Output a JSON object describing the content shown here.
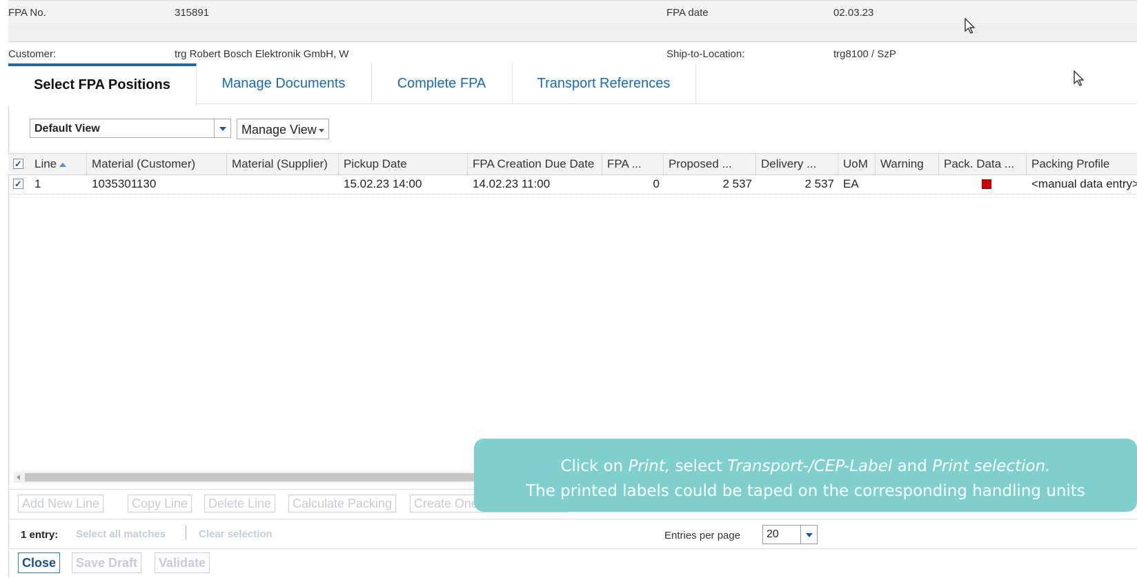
{
  "header": {
    "fpa_no_label": "FPA No.",
    "fpa_no_value": "315891",
    "fpa_date_label": "FPA date",
    "fpa_date_value": "02.03.23",
    "customer_label": "Customer:",
    "customer_value": "trg Robert Bosch Elektronik GmbH, W",
    "ship_to_label": "Ship-to-Location:",
    "ship_to_value": "trg8100 / SzP"
  },
  "tabs": [
    {
      "label": "Select FPA Positions",
      "active": true
    },
    {
      "label": "Manage Documents",
      "active": false
    },
    {
      "label": "Complete FPA",
      "active": false
    },
    {
      "label": "Transport References",
      "active": false
    }
  ],
  "view": {
    "selected": "Default View",
    "manage_label": "Manage View"
  },
  "grid": {
    "columns": [
      "Line",
      "Material (Customer)",
      "Material (Supplier)",
      "Pickup Date",
      "FPA Creation Due Date",
      "FPA ...",
      "Proposed ...",
      "Delivery ...",
      "UoM",
      "Warning",
      "Pack. Data ...",
      "Packing Profile"
    ],
    "rows": [
      {
        "line": "1",
        "material_customer": "1035301130",
        "material_supplier": "",
        "pickup_date": "15.02.23 14:00",
        "due_date": "14.02.23 11:00",
        "fpa": "0",
        "proposed": "2 537",
        "delivery": "2 537",
        "uom": "EA",
        "warning": "",
        "pack_data_status": "red",
        "packing_profile": "<manual data entry>"
      }
    ]
  },
  "toolbar": {
    "add_new_line": "Add New Line",
    "copy_line": "Copy Line",
    "delete_line": "Delete Line",
    "calculate_packing": "Calculate Packing",
    "create_one": "Create One"
  },
  "footer": {
    "entries": "1 entry:",
    "select_all": "Select all matches",
    "clear_selection": "Clear selection",
    "entries_per_page_label": "Entries per page",
    "entries_per_page_value": "20"
  },
  "actions": {
    "close": "Close",
    "save_draft": "Save Draft",
    "validate": "Validate"
  },
  "callout": {
    "line1_a": "Click on ",
    "line1_print": "Print,",
    "line1_b": " select ",
    "line1_label": "Transport-/CEP-Label",
    "line1_c": " and ",
    "line1_sel": "Print selection.",
    "line2": "The printed labels could be taped on the corresponding handling units"
  },
  "colors": {
    "accent": "#1a6aac",
    "callout_bg": "#7fcfcf",
    "status_red": "#cc0000"
  }
}
